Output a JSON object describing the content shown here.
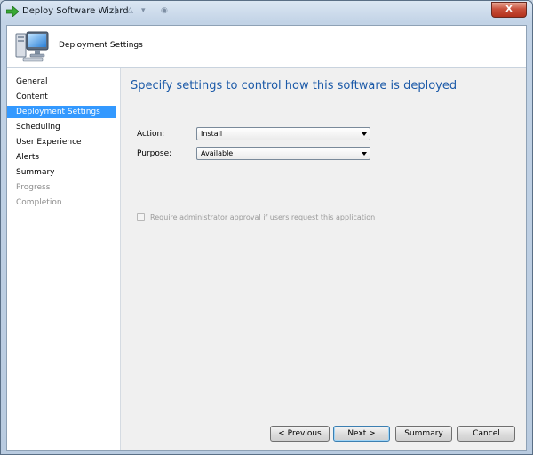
{
  "window": {
    "title": "Deploy Software Wizard",
    "close_label": "X"
  },
  "header": {
    "title": "Deployment Settings"
  },
  "nav": {
    "items": [
      {
        "label": "General",
        "state": "normal"
      },
      {
        "label": "Content",
        "state": "normal"
      },
      {
        "label": "Deployment Settings",
        "state": "selected"
      },
      {
        "label": "Scheduling",
        "state": "normal"
      },
      {
        "label": "User Experience",
        "state": "normal"
      },
      {
        "label": "Alerts",
        "state": "normal"
      },
      {
        "label": "Summary",
        "state": "normal"
      },
      {
        "label": "Progress",
        "state": "disabled"
      },
      {
        "label": "Completion",
        "state": "disabled"
      }
    ]
  },
  "main": {
    "heading": "Specify settings to control how this software is deployed",
    "action": {
      "label": "Action:",
      "value": "Install"
    },
    "purpose": {
      "label": "Purpose:",
      "value": "Available"
    },
    "approval_checkbox": {
      "label": "Require administrator approval if users request this application",
      "checked": false,
      "enabled": false
    }
  },
  "buttons": {
    "previous": "< Previous",
    "next": "Next >",
    "summary": "Summary",
    "cancel": "Cancel"
  },
  "colors": {
    "selection": "#3399ff",
    "heading": "#1c5aa8"
  }
}
